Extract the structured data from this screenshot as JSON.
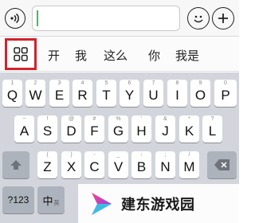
{
  "input_bar": {
    "text_value": "",
    "icons": [
      "voice-icon",
      "emoji-icon",
      "plus-icon"
    ]
  },
  "candidate_bar": {
    "grid_icon": "grid-icon",
    "candidates": [
      "开",
      "我",
      "这么",
      "你",
      "我是"
    ]
  },
  "keyboard": {
    "row1": [
      {
        "key": "Q",
        "hint": "1"
      },
      {
        "key": "W",
        "hint": "2"
      },
      {
        "key": "E",
        "hint": "3"
      },
      {
        "key": "R",
        "hint": "4"
      },
      {
        "key": "T",
        "hint": "5"
      },
      {
        "key": "Y",
        "hint": "6"
      },
      {
        "key": "U",
        "hint": "7"
      },
      {
        "key": "I",
        "hint": "8"
      },
      {
        "key": "O",
        "hint": "9"
      },
      {
        "key": "P",
        "hint": "0"
      }
    ],
    "row2": [
      {
        "key": "A",
        "hint": "~"
      },
      {
        "key": "S",
        "hint": "!"
      },
      {
        "key": "D",
        "hint": "@"
      },
      {
        "key": "F",
        "hint": "#"
      },
      {
        "key": "G",
        "hint": "%"
      },
      {
        "key": "H",
        "hint": "'"
      },
      {
        "key": "J",
        "hint": "&"
      },
      {
        "key": "K",
        "hint": "*"
      },
      {
        "key": "L",
        "hint": "?"
      }
    ],
    "row3": [
      {
        "key": "Z",
        "hint": "("
      },
      {
        "key": "X",
        "hint": ")"
      },
      {
        "key": "C",
        "hint": "-"
      },
      {
        "key": "V",
        "hint": "_"
      },
      {
        "key": "B",
        "hint": ":"
      },
      {
        "key": "N",
        "hint": ";"
      },
      {
        "key": "M",
        "hint": "/"
      }
    ],
    "numbers_key": "?123",
    "lang_key": "中",
    "lang_hint": "英"
  },
  "watermark": {
    "text": "建东游戏园"
  },
  "colors": {
    "highlight": "#d1232a",
    "cursor": "#35c25a",
    "keyboard_bg": "#d2d5db"
  }
}
